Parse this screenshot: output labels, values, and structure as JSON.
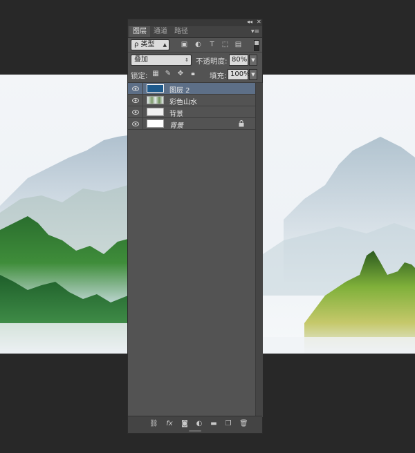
{
  "panel": {
    "tabs": [
      {
        "label": "图层",
        "active": true
      },
      {
        "label": "通道",
        "active": false
      },
      {
        "label": "路径",
        "active": false
      }
    ],
    "filter": {
      "label": "ρ 类型"
    },
    "blend_mode": "叠加",
    "opacity_label": "不透明度:",
    "opacity_value": "80%",
    "lock_label": "锁定:",
    "fill_label": "填充:",
    "fill_value": "100%",
    "layers": [
      {
        "name": "图层 2",
        "selected": true,
        "thumb": "#1e5a8c"
      },
      {
        "name": "彩色山水",
        "selected": false,
        "thumb": "landscape"
      },
      {
        "name": "背景",
        "selected": false,
        "thumb": "#f0f0f0"
      },
      {
        "name": "背景",
        "selected": false,
        "thumb": "#ffffff",
        "italic": true,
        "locked": true
      }
    ]
  },
  "colors": {
    "workspace": "#282828",
    "panel": "#535353",
    "selected_layer": "#5d6f87"
  }
}
